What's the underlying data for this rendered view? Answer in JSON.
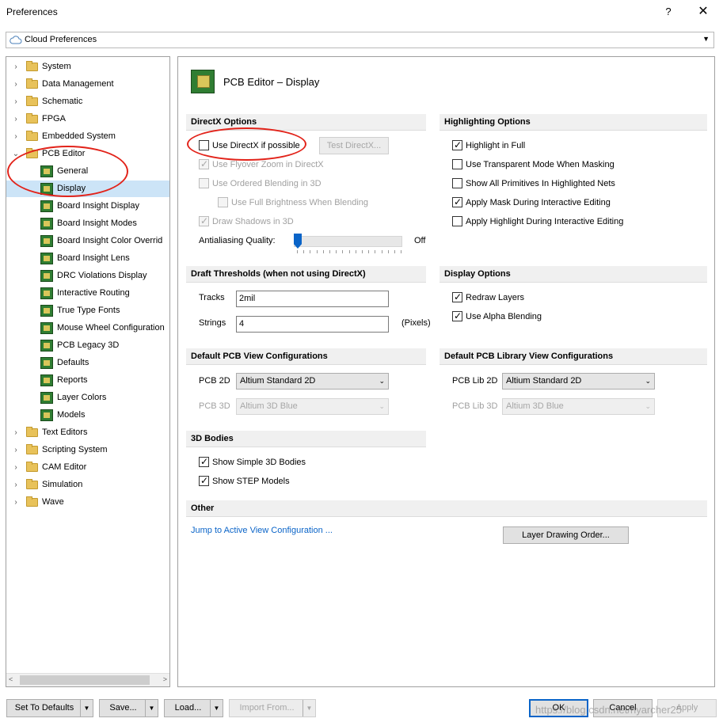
{
  "window": {
    "title": "Preferences",
    "help": "?",
    "close": "✕"
  },
  "cloud_combo": {
    "label": "Cloud Preferences"
  },
  "tree": {
    "items": [
      {
        "label": "System",
        "level": 0,
        "chevron": "›",
        "icon": "folder-icon"
      },
      {
        "label": "Data Management",
        "level": 0,
        "chevron": "›",
        "icon": "folder-icon"
      },
      {
        "label": "Schematic",
        "level": 0,
        "chevron": "›",
        "icon": "folder-icon"
      },
      {
        "label": "FPGA",
        "level": 0,
        "chevron": "›",
        "icon": "folder-icon"
      },
      {
        "label": "Embedded System",
        "level": 0,
        "chevron": "›",
        "icon": "folder-icon"
      },
      {
        "label": "PCB Editor",
        "level": 0,
        "chevron": "⌄",
        "icon": "folder-icon"
      },
      {
        "label": "General",
        "level": 1,
        "icon": "pcb-icon"
      },
      {
        "label": "Display",
        "level": 1,
        "icon": "pcb-icon",
        "selected": true
      },
      {
        "label": "Board Insight Display",
        "level": 1,
        "icon": "pcb-icon"
      },
      {
        "label": "Board Insight Modes",
        "level": 1,
        "icon": "pcb-icon"
      },
      {
        "label": "Board Insight Color Overrid",
        "level": 1,
        "icon": "pcb-icon"
      },
      {
        "label": "Board Insight Lens",
        "level": 1,
        "icon": "pcb-icon"
      },
      {
        "label": "DRC Violations Display",
        "level": 1,
        "icon": "pcb-icon"
      },
      {
        "label": "Interactive Routing",
        "level": 1,
        "icon": "pcb-icon"
      },
      {
        "label": "True Type Fonts",
        "level": 1,
        "icon": "pcb-icon"
      },
      {
        "label": "Mouse Wheel Configuration",
        "level": 1,
        "icon": "pcb-icon"
      },
      {
        "label": "PCB Legacy 3D",
        "level": 1,
        "icon": "pcb-icon"
      },
      {
        "label": "Defaults",
        "level": 1,
        "icon": "pcb-icon"
      },
      {
        "label": "Reports",
        "level": 1,
        "icon": "pcb-icon"
      },
      {
        "label": "Layer Colors",
        "level": 1,
        "icon": "pcb-icon"
      },
      {
        "label": "Models",
        "level": 1,
        "icon": "pcb-icon"
      },
      {
        "label": "Text Editors",
        "level": 0,
        "chevron": "›",
        "icon": "folder-icon"
      },
      {
        "label": "Scripting System",
        "level": 0,
        "chevron": "›",
        "icon": "folder-icon"
      },
      {
        "label": "CAM Editor",
        "level": 0,
        "chevron": "›",
        "icon": "folder-icon"
      },
      {
        "label": "Simulation",
        "level": 0,
        "chevron": "›",
        "icon": "folder-icon"
      },
      {
        "label": "Wave",
        "level": 0,
        "chevron": "›",
        "icon": "folder-icon"
      }
    ],
    "scroll_left": "<",
    "scroll_right": ">"
  },
  "page": {
    "title": "PCB Editor – Display"
  },
  "directx": {
    "section": "DirectX Options",
    "use_directx": "Use DirectX if possible",
    "test_button": "Test DirectX...",
    "flyover": "Use Flyover Zoom in DirectX",
    "ordered_blending": "Use Ordered Blending in 3D",
    "full_brightness": "Use Full Brightness When Blending",
    "draw_shadows": "Draw Shadows in 3D",
    "antialiasing_label": "Antialiasing Quality:",
    "antialiasing_value": "Off",
    "antialiasing_level": 0
  },
  "highlighting": {
    "section": "Highlighting Options",
    "items": [
      {
        "label": "Highlight in Full",
        "checked": true
      },
      {
        "label": "Use Transparent Mode When Masking",
        "checked": false
      },
      {
        "label": "Show All Primitives In Highlighted Nets",
        "checked": false
      },
      {
        "label": "Apply Mask During Interactive Editing",
        "checked": true
      },
      {
        "label": "Apply Highlight During Interactive Editing",
        "checked": false
      }
    ]
  },
  "draft": {
    "section": "Draft Thresholds (when not using DirectX)",
    "tracks_label": "Tracks",
    "tracks_value": "2mil",
    "strings_label": "Strings",
    "strings_value": "4",
    "strings_unit": "(Pixels)"
  },
  "display_options": {
    "section": "Display Options",
    "redraw": "Redraw Layers",
    "alpha": "Use Alpha Blending"
  },
  "pcb_view": {
    "section": "Default PCB View Configurations",
    "pcb2d_label": "PCB 2D",
    "pcb2d_value": "Altium Standard 2D",
    "pcb3d_label": "PCB 3D",
    "pcb3d_value": "Altium 3D Blue"
  },
  "pcblib_view": {
    "section": "Default PCB Library View Configurations",
    "lib2d_label": "PCB Lib 2D",
    "lib2d_value": "Altium Standard 2D",
    "lib3d_label": "PCB Lib 3D",
    "lib3d_value": "Altium 3D Blue"
  },
  "bodies": {
    "section": "3D Bodies",
    "simple": "Show Simple 3D Bodies",
    "step": "Show STEP Models"
  },
  "other": {
    "section": "Other",
    "jump_link": "Jump to Active View Configuration ...",
    "layer_order_button": "Layer Drawing Order..."
  },
  "bottom": {
    "set_defaults": "Set To Defaults",
    "save": "Save...",
    "load": "Load...",
    "import": "Import From...",
    "ok": "OK",
    "cancel": "Cancel",
    "apply": "Apply",
    "split_arrow": "▼"
  },
  "watermark": "https://blog.csdn.net/hyarcher25",
  "colors": {
    "accent": "#0a64c8",
    "annotation_red": "#e2231a",
    "selection": "#cce4f7"
  }
}
